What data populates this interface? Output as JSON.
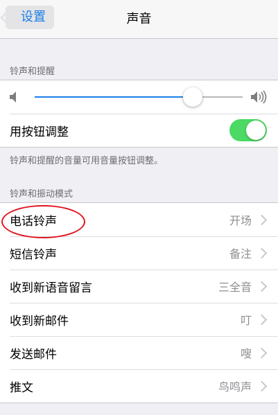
{
  "navbar": {
    "back_label": "设置",
    "title": "声音"
  },
  "sections": {
    "ringer_header": "铃声和提醒",
    "ringer_volume_level": 0.76,
    "change_with_buttons_label": "用按钮调整",
    "change_with_buttons_on": true,
    "ringer_footer": "铃声和提醒的音量可用音量按钮调整。",
    "patterns_header": "铃声和振动模式"
  },
  "sound_items": [
    {
      "label": "电话铃声",
      "value": "开场"
    },
    {
      "label": "短信铃声",
      "value": "备注"
    },
    {
      "label": "收到新语音留言",
      "value": "三全音"
    },
    {
      "label": "收到新邮件",
      "value": "叮"
    },
    {
      "label": "发送邮件",
      "value": "嗖"
    },
    {
      "label": "推文",
      "value": "鸟鸣声"
    }
  ],
  "colors": {
    "accent": "#1a7fe6",
    "toggle_on": "#4cd964",
    "annotation": "#e0141e"
  }
}
